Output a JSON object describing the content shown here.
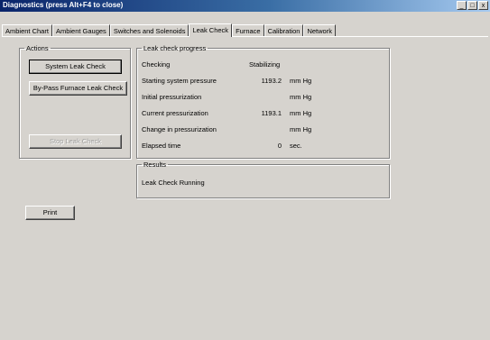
{
  "window": {
    "title": "Diagnostics (press Alt+F4 to close)",
    "controls": [
      "_",
      "□",
      "x"
    ]
  },
  "tabs": [
    {
      "label": "Ambient Chart"
    },
    {
      "label": "Ambient Gauges"
    },
    {
      "label": "Switches and Solenoids"
    },
    {
      "label": "Leak Check",
      "active": true
    },
    {
      "label": "Furnace"
    },
    {
      "label": "Calibration"
    },
    {
      "label": "Network"
    }
  ],
  "actions": {
    "title": "Actions",
    "system_leak_check": "System Leak Check",
    "bypass_leak_check": "By-Pass Furnace Leak Check",
    "stop_leak_check": "Stop Leak Check"
  },
  "progress": {
    "title": "Leak check progress",
    "rows": [
      {
        "label": "Checking",
        "value": "Stabilizing",
        "unit": ""
      },
      {
        "label": "Starting system pressure",
        "value": "1193.2",
        "unit": "mm Hg"
      },
      {
        "label": "Initial pressurization",
        "value": "",
        "unit": "mm Hg"
      },
      {
        "label": "Current pressurization",
        "value": "1193.1",
        "unit": "mm Hg"
      },
      {
        "label": "Change in pressurization",
        "value": "",
        "unit": "mm Hg"
      },
      {
        "label": "Elapsed time",
        "value": "0",
        "unit": "sec."
      }
    ]
  },
  "results": {
    "title": "Results",
    "text": "Leak Check Running"
  },
  "print_label": "Print"
}
